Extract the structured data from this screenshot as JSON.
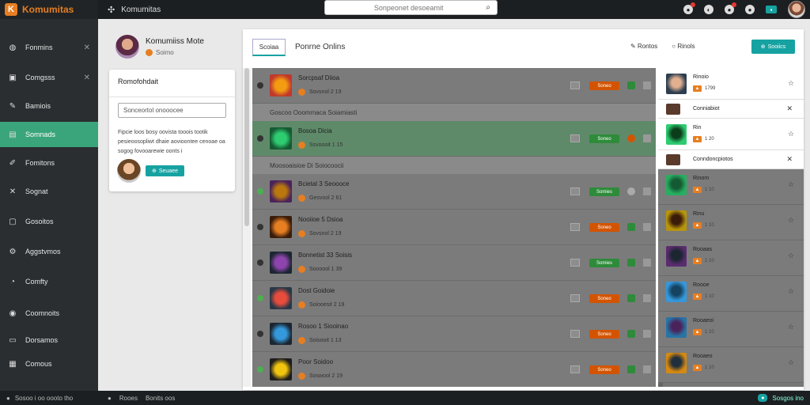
{
  "app": {
    "brand": "Komumitas",
    "breadcrumb": "Komumitas",
    "search_placeholder": "Sonpeonet desoeamit"
  },
  "sidebar": {
    "items": [
      {
        "label": "Fonmins",
        "icon": "shield-icon",
        "closable": true,
        "active": false
      },
      {
        "label": "Comgsss",
        "icon": "inbox-icon",
        "closable": true,
        "active": false
      },
      {
        "label": "Bamiois",
        "icon": "pencil-icon",
        "closable": false,
        "active": false
      },
      {
        "label": "Somnads",
        "icon": "card-icon",
        "closable": false,
        "active": true
      },
      {
        "label": "Fomitons",
        "icon": "edit-icon",
        "closable": false,
        "active": false
      },
      {
        "label": "Sognat",
        "icon": "tools-icon",
        "closable": false,
        "active": false
      },
      {
        "label": "Gosoitos",
        "icon": "box-icon",
        "closable": false,
        "active": false
      },
      {
        "label": "Aggstvmos",
        "icon": "gear-icon",
        "closable": false,
        "active": false
      },
      {
        "label": "Comfty",
        "icon": "clock-icon",
        "closable": false,
        "active": false
      },
      {
        "label": "Coomnoits",
        "icon": "globe-icon",
        "closable": false,
        "active": false
      },
      {
        "label": "Dorsamos",
        "icon": "folder-icon",
        "closable": false,
        "active": false
      },
      {
        "label": "Comous",
        "icon": "grid-icon",
        "closable": false,
        "active": false
      }
    ]
  },
  "profile": {
    "name": "Komumiiss Mote",
    "sub": "Soimo"
  },
  "profile_card": {
    "title": "Romofohdait",
    "input_value": "Sonceortol onooocee",
    "text": "Fipcie loos bosy oovista tooois tootik pesieoosopliwt dhaie aovioontee cenoae oa sogog fovooarewie oonts i",
    "button_label": "Seuaee"
  },
  "panel": {
    "tab_label": "Scoiaa",
    "title": "Ponrne Onlins",
    "tool_1": "Rontos",
    "tool_2": "Rinols",
    "action_label": "Sooiics"
  },
  "list": [
    {
      "kind": "item",
      "title": "Sorcpsaf Diioa",
      "sub": "Sovsnol  2 19",
      "chip": "Soneo",
      "chip_color": "r",
      "mini": "g",
      "dot": "d",
      "thumb": [
        "#f39c12",
        "#c0392b"
      ]
    },
    {
      "kind": "group",
      "title": "Goscoo Ooommaca Soiamiasti"
    },
    {
      "kind": "item",
      "title": "Bosoa Dicia",
      "sub": "Ssvoooit  1 15",
      "chip": "Soneo",
      "chip_color": "g",
      "mini": "o",
      "dot": "d",
      "hl": true,
      "thumb": [
        "#2ecc71",
        "#145a32"
      ]
    },
    {
      "kind": "group",
      "title": "Moosoaisioe Di Soiocoocii"
    },
    {
      "kind": "item",
      "title": "Bcietal 3 Seoooce",
      "sub": "Gesvool  2 61",
      "chip": "Somies",
      "chip_color": "g",
      "mini": "gray",
      "dot": "g",
      "thumb": [
        "#b9770e",
        "#4a235a"
      ]
    },
    {
      "kind": "item",
      "title": "Nooiioe 5 Dsioa",
      "sub": "Sovsnol  2 19",
      "chip": "Soneo",
      "chip_color": "r",
      "mini": "g",
      "dot": "d",
      "thumb": [
        "#e67e22",
        "#3b1c0a"
      ]
    },
    {
      "kind": "item",
      "title": "Bonnetist 33 Soisis",
      "sub": "Soooool  1 39",
      "chip": "Somies",
      "chip_color": "g",
      "mini": "g",
      "dot": "d",
      "thumb": [
        "#8e44ad",
        "#1b2631"
      ]
    },
    {
      "kind": "item",
      "title": "Dost Goidoie",
      "sub": "Soiooesit  2 19",
      "chip": "Soneo",
      "chip_color": "r",
      "mini": "g",
      "dot": "g",
      "thumb": [
        "#e74c3c",
        "#283747"
      ]
    },
    {
      "kind": "item",
      "title": "Rosoo 1 Siooinao",
      "sub": "Soisooit  1 13",
      "chip": "Soneo",
      "chip_color": "r",
      "mini": "g",
      "dot": "d",
      "thumb": [
        "#3498db",
        "#1b2631"
      ]
    },
    {
      "kind": "item",
      "title": "Poor Soidoo",
      "sub": "Soswool  2 19",
      "chip": "Soneo",
      "chip_color": "r",
      "mini": "g",
      "dot": "g",
      "thumb": [
        "#f1c40f",
        "#1c1c1c"
      ]
    }
  ],
  "right": [
    {
      "kind": "card",
      "title": "Rinoio",
      "meta": "1799",
      "thumb": [
        "#2c3e50",
        "#e0b090"
      ]
    },
    {
      "kind": "header",
      "title": "Conniabiot",
      "closable": true
    },
    {
      "kind": "card",
      "title": "Rin",
      "meta": "1  20",
      "thumb": [
        "#2ecc71",
        "#0b3d1a"
      ]
    },
    {
      "kind": "header",
      "title": "Conndoncpiotos",
      "closable": true
    },
    {
      "kind": "dim",
      "title": "Rinom",
      "meta": "1  10",
      "thumb": [
        "#27ae60",
        "#145a32"
      ]
    },
    {
      "kind": "dim",
      "title": "Rinu",
      "meta": "1  10",
      "thumb": [
        "#b7950b",
        "#3b1c0a"
      ]
    },
    {
      "kind": "dim",
      "title": "Rooaas",
      "meta": "1  10",
      "thumb": [
        "#5b2c6f",
        "#1b2631"
      ]
    },
    {
      "kind": "dim",
      "title": "Roooe",
      "meta": "1  10",
      "thumb": [
        "#3498db",
        "#154360"
      ]
    },
    {
      "kind": "dim",
      "title": "Rooaeoi",
      "meta": "1  10",
      "thumb": [
        "#2874a6",
        "#4a235a"
      ]
    },
    {
      "kind": "dim",
      "title": "Rooaeo",
      "meta": "1  10",
      "thumb": [
        "#d68910",
        "#212f3c"
      ]
    }
  ],
  "footer": {
    "left": "Sosoo i oo oooto tho",
    "mid_1": "Rooes",
    "mid_2": "Bonits oos",
    "right": "Sosgos ino"
  },
  "colors": {
    "brand": "#e67e22",
    "accent": "#17a2a2",
    "active_nav": "#3aa57a",
    "chip_red": "#d35400",
    "chip_green": "#2e8b3a"
  }
}
